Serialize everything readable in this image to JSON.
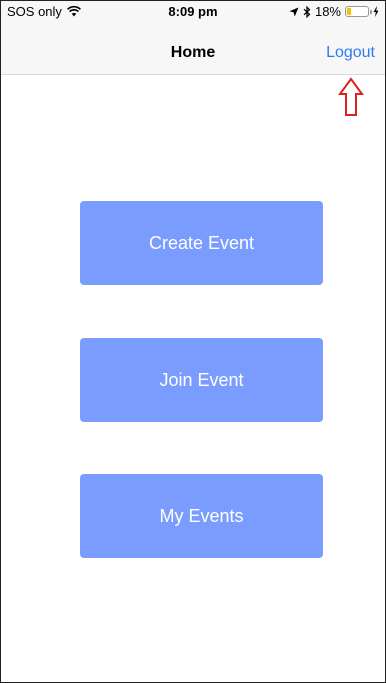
{
  "status_bar": {
    "carrier": "SOS only",
    "time": "8:09 pm",
    "battery_percent": "18%",
    "battery_level": 0.18
  },
  "nav": {
    "title": "Home",
    "logout_label": "Logout"
  },
  "buttons": {
    "create_event": "Create Event",
    "join_event": "Join Event",
    "my_events": "My Events"
  },
  "colors": {
    "button_bg": "#7b9cff",
    "link_blue": "#2f7bf5",
    "arrow_red": "#e02020",
    "battery_yellow": "#f5c400"
  },
  "icons": {
    "wifi": "wifi-icon",
    "location": "location-arrow-icon",
    "bluetooth": "bluetooth-icon",
    "battery": "battery-icon",
    "charging": "charging-bolt-icon",
    "annotation": "up-arrow-icon"
  }
}
